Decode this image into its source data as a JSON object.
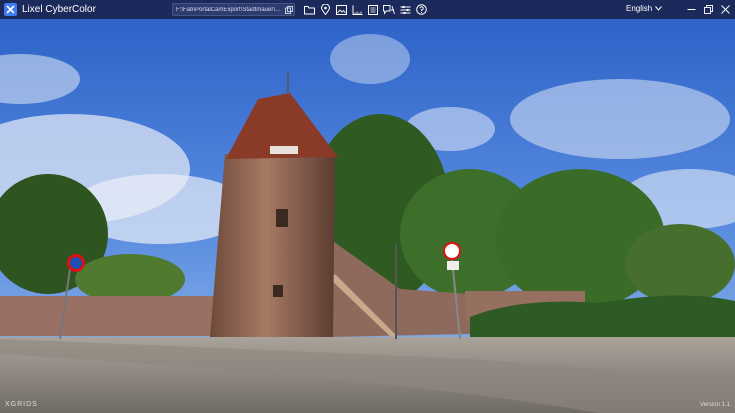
{
  "app": {
    "title": "Lixel CyberColor"
  },
  "toolbar": {
    "path": "F:\\Fab\\PortalCamExport\\Stadtmauer\\LCC",
    "icons": [
      "folder-icon",
      "location-pin-icon",
      "image-icon",
      "measure-icon",
      "list-icon",
      "annotation-icon",
      "sliders-icon",
      "help-icon"
    ]
  },
  "language": {
    "selected": "English"
  },
  "viewport": {
    "watermark": "XGRIDS",
    "version": "Version 1.1"
  },
  "colors": {
    "titlebar": "#1b2a5a",
    "accent": "#3d7bf0"
  }
}
